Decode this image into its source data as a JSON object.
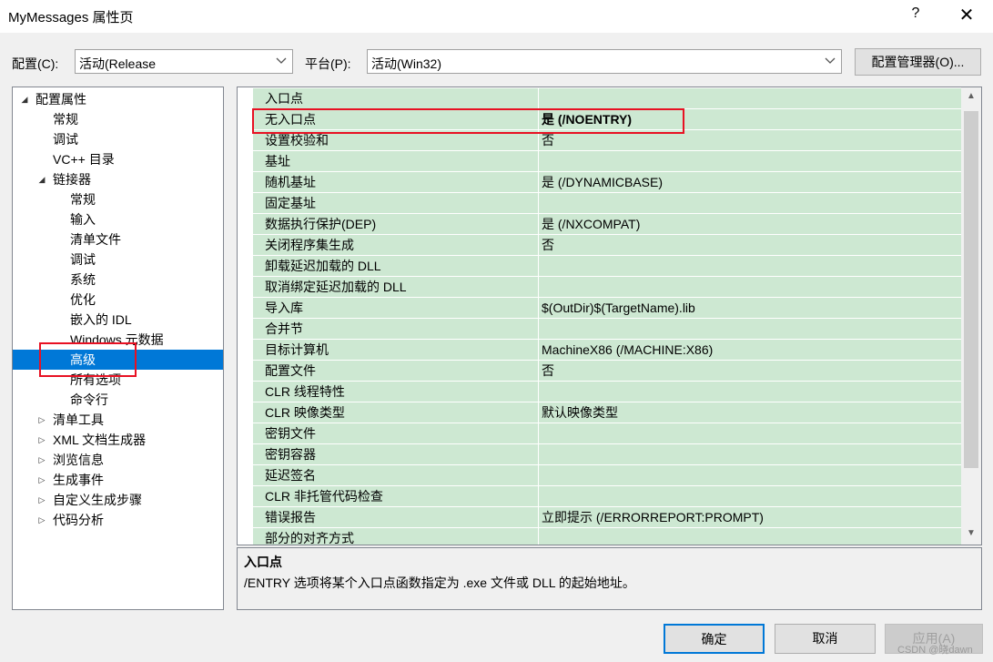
{
  "window": {
    "title": "MyMessages 属性页",
    "help_glyph": "?",
    "close_glyph": "✕"
  },
  "toolbar": {
    "config_label": "配置(C):",
    "config_value": "活动(Release",
    "platform_label": "平台(P):",
    "platform_value": "活动(Win32)",
    "config_manager_label": "配置管理器(O)..."
  },
  "tree": {
    "items": [
      {
        "label": "配置属性",
        "expander": "◢"
      },
      {
        "label": "常规"
      },
      {
        "label": "调试"
      },
      {
        "label": "VC++ 目录"
      },
      {
        "label": "链接器",
        "expander": "◢"
      },
      {
        "label": "常规"
      },
      {
        "label": "输入"
      },
      {
        "label": "清单文件"
      },
      {
        "label": "调试"
      },
      {
        "label": "系统"
      },
      {
        "label": "优化"
      },
      {
        "label": "嵌入的 IDL"
      },
      {
        "label": "Windows 元数据"
      },
      {
        "label": "高级",
        "selected": true
      },
      {
        "label": "所有选项"
      },
      {
        "label": "命令行"
      },
      {
        "label": "清单工具",
        "expander": "▷"
      },
      {
        "label": "XML 文档生成器",
        "expander": "▷"
      },
      {
        "label": "浏览信息",
        "expander": "▷"
      },
      {
        "label": "生成事件",
        "expander": "▷"
      },
      {
        "label": "自定义生成步骤",
        "expander": "▷"
      },
      {
        "label": "代码分析",
        "expander": "▷"
      }
    ]
  },
  "grid": {
    "rows": [
      {
        "name": "入口点",
        "value": ""
      },
      {
        "name": "无入口点",
        "value": "是 (/NOENTRY)",
        "bold": true
      },
      {
        "name": "设置校验和",
        "value": "否"
      },
      {
        "name": "基址",
        "value": ""
      },
      {
        "name": "随机基址",
        "value": "是 (/DYNAMICBASE)"
      },
      {
        "name": "固定基址",
        "value": ""
      },
      {
        "name": "数据执行保护(DEP)",
        "value": "是 (/NXCOMPAT)"
      },
      {
        "name": "关闭程序集生成",
        "value": "否"
      },
      {
        "name": "卸载延迟加载的 DLL",
        "value": ""
      },
      {
        "name": "取消绑定延迟加载的 DLL",
        "value": ""
      },
      {
        "name": "导入库",
        "value": "$(OutDir)$(TargetName).lib"
      },
      {
        "name": "合并节",
        "value": ""
      },
      {
        "name": "目标计算机",
        "value": "MachineX86 (/MACHINE:X86)"
      },
      {
        "name": "配置文件",
        "value": "否"
      },
      {
        "name": "CLR 线程特性",
        "value": ""
      },
      {
        "name": "CLR 映像类型",
        "value": "默认映像类型"
      },
      {
        "name": "密钥文件",
        "value": ""
      },
      {
        "name": "密钥容器",
        "value": ""
      },
      {
        "name": "延迟签名",
        "value": ""
      },
      {
        "name": "CLR 非托管代码检查",
        "value": ""
      },
      {
        "name": "错误报告",
        "value": "立即提示 (/ERRORREPORT:PROMPT)"
      },
      {
        "name": "部分的对齐方式",
        "value": ""
      }
    ]
  },
  "description": {
    "title": "入口点",
    "text": "/ENTRY 选项将某个入口点函数指定为 .exe 文件或 DLL 的起始地址。"
  },
  "buttons": {
    "ok": "确定",
    "cancel": "取消",
    "apply": "应用(A)"
  },
  "watermark": "CSDN @晓dawn",
  "colors": {
    "grid_bg": "#cde8d2",
    "selection": "#0078d7",
    "annotation": "#e81123"
  }
}
